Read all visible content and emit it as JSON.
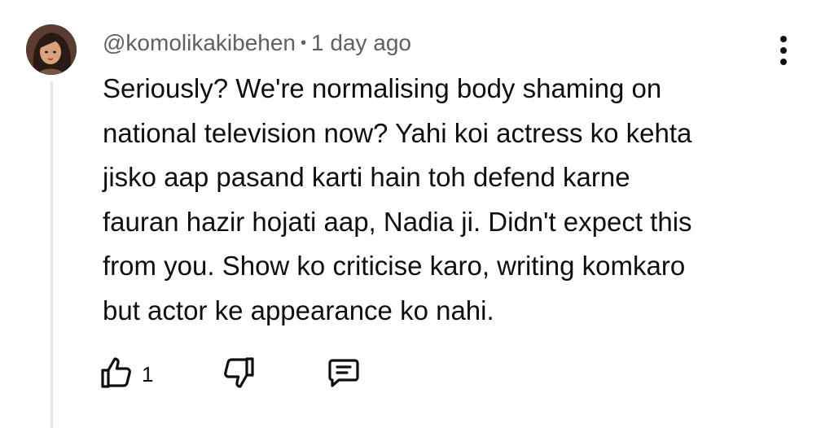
{
  "comment": {
    "author": "@komolikakibehen",
    "separator": "•",
    "time": "1 day ago",
    "text_lines": [
      "Seriously? We're normalising body shaming on",
      "national television now? Yahi koi actress ko kehta",
      "jisko aap pasand karti hain toh defend karne",
      "fauran hazir hojati aap, Nadia ji. Didn't expect this",
      "from you. Show ko criticise karo, writing komkaro",
      "but actor ke appearance ko nahi."
    ],
    "like_count": "1"
  },
  "icons": {
    "menu": "more-vert-icon",
    "like": "thumbs-up-icon",
    "dislike": "thumbs-down-icon",
    "reply": "comment-icon"
  },
  "colors": {
    "text": "#0f0f0f",
    "meta": "#606060",
    "thread_line": "#e5e5e5"
  }
}
